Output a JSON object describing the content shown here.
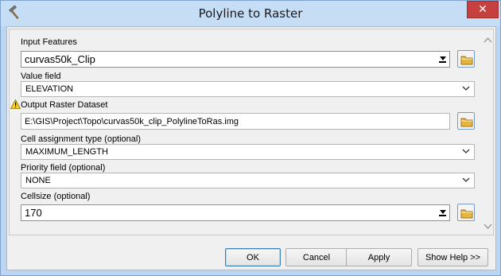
{
  "window": {
    "title": "Polyline to Raster",
    "close_glyph": "✕",
    "app_icon": "hammer-icon"
  },
  "form": {
    "input_features": {
      "label": "Input Features",
      "value": "curvas50k_Clip"
    },
    "value_field": {
      "label": "Value field",
      "value": "ELEVATION"
    },
    "output_raster": {
      "label": "Output Raster Dataset",
      "value": "E:\\GIS\\Project\\Topo\\curvas50k_clip_PolylineToRas.img",
      "warning_icon": "warning-icon"
    },
    "cell_assignment": {
      "label": "Cell assignment type (optional)",
      "value": "MAXIMUM_LENGTH"
    },
    "priority_field": {
      "label": "Priority field (optional)",
      "value": "NONE"
    },
    "cellsize": {
      "label": "Cellsize (optional)",
      "value": "170"
    }
  },
  "buttons": {
    "ok": "OK",
    "cancel": "Cancel",
    "apply": "Apply",
    "show_help": "Show Help >>"
  },
  "colors": {
    "title_bar": "#c6ddf6",
    "close": "#c74040",
    "client": "#f0f0f0",
    "folder_icon": "#e8b43a",
    "warning": "#f4d21f"
  }
}
